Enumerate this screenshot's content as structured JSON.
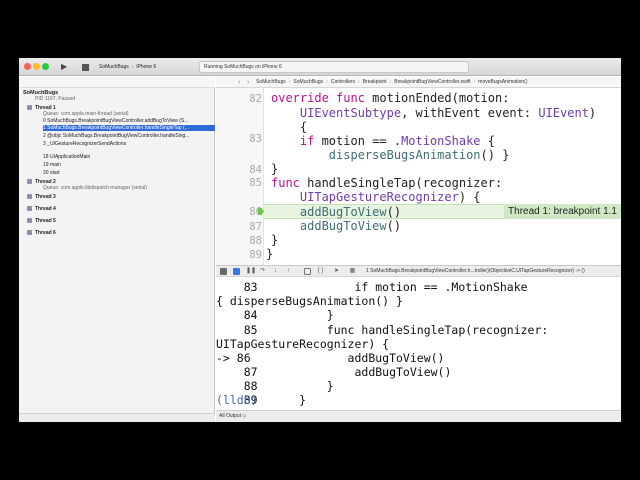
{
  "toolbar": {
    "scheme_app": "SoMuchBugs",
    "scheme_device": "iPhone 6",
    "status": "Running SoMuchBugs on iPhone 6",
    "run_glyph": "▶"
  },
  "navigator": {
    "project": "SoMuchBugs",
    "process": "PID 1197, Paused",
    "thread1": "Thread 1",
    "thread1_queue": "Queue: com.apple.main-thread (serial)",
    "frames": [
      "0 SoMuchBugs.BreakpointBugViewController.addBugToView (S...",
      "1 SoMuchBugs.BreakpointBugViewController.handleSingleTap (...",
      "2 @objc SoMuchBugs.BreakpointBugViewController.handleSing...",
      "3 _UIGestureRecognizerSendActions",
      "18 UIApplicationMain",
      "19 main",
      "20 start"
    ],
    "thread2": "Thread 2",
    "thread2_queue": "Queue: com.apple.libdispatch-manager (serial)",
    "thread3": "Thread 3",
    "thread4": "Thread 4",
    "thread5": "Thread 5",
    "thread6": "Thread 6"
  },
  "jumpbar": {
    "items": [
      "SoMuchBugs",
      "SoMuchBugs",
      "Controllers",
      "Breakpoint",
      "BreakpointBugViewController.swift",
      "moveBugsAnimation()"
    ]
  },
  "editor": {
    "line_numbers": [
      "82",
      "83",
      "84",
      "85",
      "86",
      "87",
      "88",
      "89"
    ],
    "breakpoint_badge": "Thread 1: breakpoint 1.1"
  },
  "debugbar": {
    "path": "1 SoMuchBugs.BreakpointBugViewController.h...troller)(ObjectiveC.UITapGestureRecognizer) -> ()"
  },
  "console": {
    "lines": [
      "    83              if motion == .MotionShake",
      "{ disperseBugsAnimation() }",
      "    84          }",
      "    85          func handleSingleTap(recognizer:",
      "UITapGestureRecognizer) {",
      "-> 86              addBugToView()",
      "    87              addBugToView()",
      "    88          }",
      "    89      }"
    ],
    "prompt": "(lldb)",
    "output_selector": "All Output ◇"
  },
  "colors": {
    "keyword": "#b5138f",
    "type": "#703daa",
    "selection": "#2f6cd8",
    "breakpoint_line": "#e6f4e0"
  }
}
